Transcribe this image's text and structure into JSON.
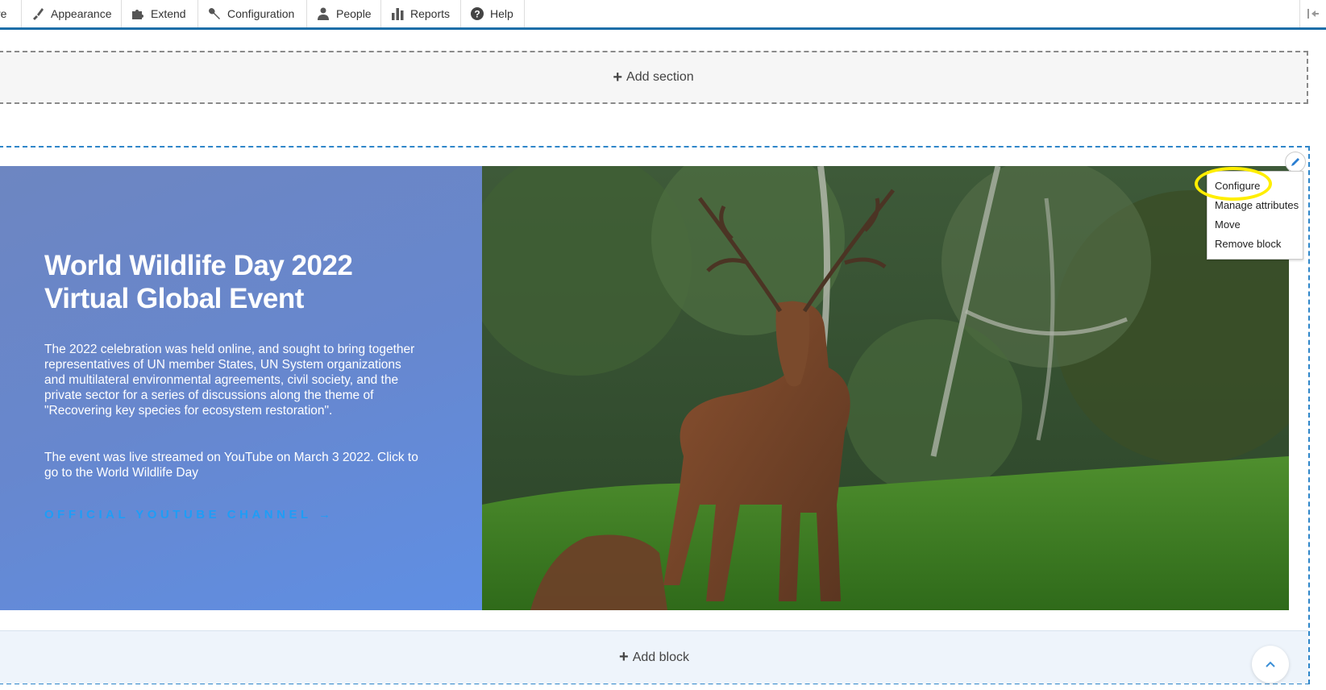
{
  "toolbar": {
    "cut_item": "re",
    "items": [
      {
        "label": "Appearance",
        "icon": "brush-icon"
      },
      {
        "label": "Extend",
        "icon": "puzzle-icon"
      },
      {
        "label": "Configuration",
        "icon": "wrench-icon"
      },
      {
        "label": "People",
        "icon": "people-icon"
      },
      {
        "label": "Reports",
        "icon": "bar-chart-icon"
      },
      {
        "label": "Help",
        "icon": "help-icon"
      }
    ],
    "collapse_icon": "collapse-left-icon",
    "accent_color": "#1d6ea8"
  },
  "layout": {
    "add_section_label": "Add section",
    "add_block_label": "Add block"
  },
  "hero": {
    "title": "World Wildlife Day 2022 Virtual Global Event",
    "paragraph1": "The 2022 celebration was held online, and sought to bring together representatives of UN member States, UN System organizations and multilateral environmental agreements, civil society, and the private sector for a series of discussions along the theme of",
    "paragraph1_quote": "\"Recovering key species for ecosystem restoration\".",
    "paragraph2": "The event was live streamed on YouTube on March 3 2022. Click to go to the World Wildlife Day",
    "link_label": "OFFICIAL YOUTUBE CHANNEL",
    "link_arrow": "→",
    "image": "red deer stag standing in a green forest clearing",
    "link_color": "#1f9df5"
  },
  "context_menu": {
    "items": [
      "Configure",
      "Manage attributes",
      "Move",
      "Remove block"
    ],
    "highlighted": "Configure"
  }
}
